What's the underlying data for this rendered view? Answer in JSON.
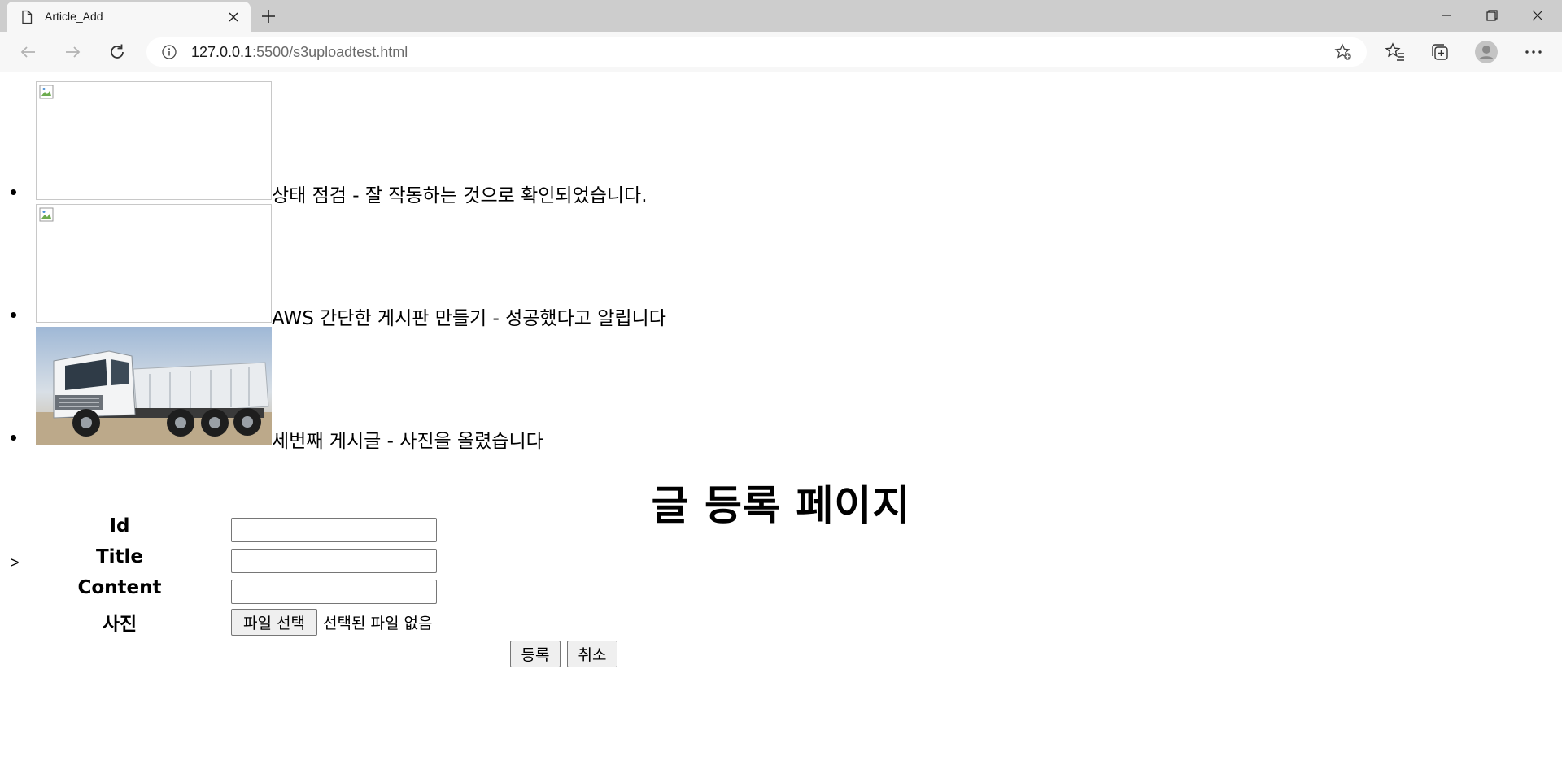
{
  "browser": {
    "tab": {
      "title": "Article_Add"
    },
    "address": {
      "host": "127.0.0.1",
      "rest": ":5500/s3uploadtest.html"
    },
    "icons": {
      "tab": "document-icon",
      "close": "close-icon",
      "new_tab": "plus-icon",
      "back": "arrow-left-icon",
      "forward": "arrow-right-icon",
      "reload": "reload-icon",
      "info": "info-icon",
      "add_favorite": "star-plus-icon",
      "favorites": "favorites-icon",
      "collections": "collections-icon",
      "profile": "profile-icon",
      "menu": "more-icon"
    }
  },
  "articles": [
    {
      "text": "상태 점검 - 잘 작동하는 것으로 확인되었습니다.",
      "image": "broken-image"
    },
    {
      "text": "AWS 간단한 게시판 만들기 - 성공했다고 알립니다",
      "image": "broken-image"
    },
    {
      "text": "세번째 게시글 - 사진을 올렸습니다",
      "image": "truck-photo"
    }
  ],
  "form": {
    "heading": "글 등록 페이지",
    "stray_text": ">",
    "labels": {
      "id": "Id",
      "title": "Title",
      "content": "Content",
      "photo": "사진"
    },
    "values": {
      "id": "",
      "title": "",
      "content": ""
    },
    "file_button": "파일 선택",
    "file_status": "선택된 파일 없음",
    "submit": "등록",
    "cancel": "취소"
  }
}
